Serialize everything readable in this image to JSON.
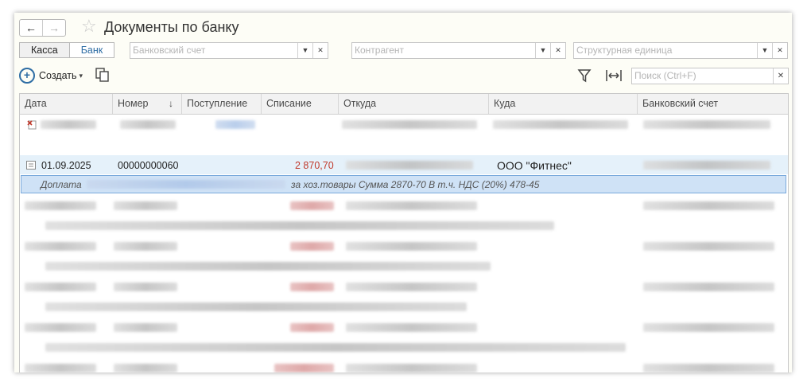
{
  "header": {
    "title": "Документы по банку"
  },
  "tabs": {
    "cash": "Касса",
    "bank": "Банк"
  },
  "filters": {
    "bank_account": "Банковский счет",
    "counterparty": "Контрагент",
    "structural_unit": "Структурная единица"
  },
  "toolbar": {
    "create_label": "Создать",
    "search_placeholder": "Поиск (Ctrl+F)"
  },
  "columns": [
    "Дата",
    "Номер",
    "Поступление",
    "Списание",
    "Откуда",
    "Куда",
    "Банковский счет"
  ],
  "selected_row": {
    "date": "01.09.2025",
    "number": "00000000060",
    "write_off": "2 870,70",
    "to": "ООО \"Фитнес\""
  },
  "detail_row": {
    "prefix": "Доплата",
    "purpose": "за хоз.товары Сумма 2870-70 В т.ч. НДС  (20%) 478-45"
  },
  "colors": {
    "accent": "#2e6da4",
    "writeoff": "#c0392b",
    "selection": "#e5f1fa",
    "detail": "#cfe2f6"
  }
}
